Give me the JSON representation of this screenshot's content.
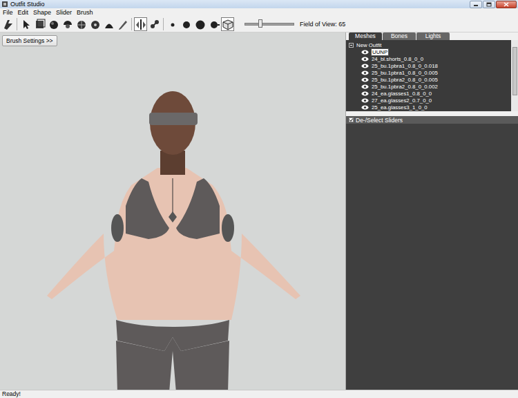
{
  "window": {
    "title": "Outfit Studio"
  },
  "menu": [
    "File",
    "Edit",
    "Shape",
    "Slider",
    "Brush"
  ],
  "toolbar": {
    "tools": [
      {
        "selected": false
      },
      {
        "selected": false
      },
      {
        "selected": false
      },
      {
        "selected": false
      },
      {
        "selected": false
      },
      {
        "selected": false
      },
      {
        "selected": false
      },
      {
        "selected": false
      },
      {
        "selected": false
      },
      {
        "selected": true
      },
      {
        "selected": false
      },
      {
        "selected": false
      },
      {
        "selected": false
      },
      {
        "selected": false
      },
      {
        "selected": false
      },
      {
        "selected": true
      }
    ],
    "fov": {
      "label": "Field of View: 65",
      "level": 0.32
    }
  },
  "brush_settings": "Brush Settings >>",
  "tabs": [
    {
      "label": "Meshes",
      "selected": true
    },
    {
      "label": "Bones",
      "selected": false
    },
    {
      "label": "Lights",
      "selected": false
    }
  ],
  "tree": {
    "root": {
      "label": "New Outfit",
      "expanded": true
    },
    "meshes": [
      {
        "label": "UUNP",
        "visible": true,
        "selected": true
      },
      {
        "label": "24_bl.shorts_0.8_0_0",
        "visible": true,
        "selected": false
      },
      {
        "label": "25_bu.1pbra1_0.8_0_0.018",
        "visible": true,
        "selected": false
      },
      {
        "label": "25_bu.1pbra1_0.8_0_0.005",
        "visible": true,
        "selected": false
      },
      {
        "label": "25_bu.1pbra2_0.8_0_0.005",
        "visible": true,
        "selected": false
      },
      {
        "label": "25_bu.1pbra2_0.8_0_0.002",
        "visible": true,
        "selected": false
      },
      {
        "label": "24_ea.glasses1_0.8_0_0",
        "visible": true,
        "selected": false
      },
      {
        "label": "27_ea.glasses2_0.7_0_0",
        "visible": true,
        "selected": false
      },
      {
        "label": "25_ea.glasses3_1_0_0",
        "visible": true,
        "selected": false
      }
    ]
  },
  "sliders_panel": {
    "label": "De-/Select Sliders",
    "checked": true
  },
  "status_bar": "Ready!"
}
